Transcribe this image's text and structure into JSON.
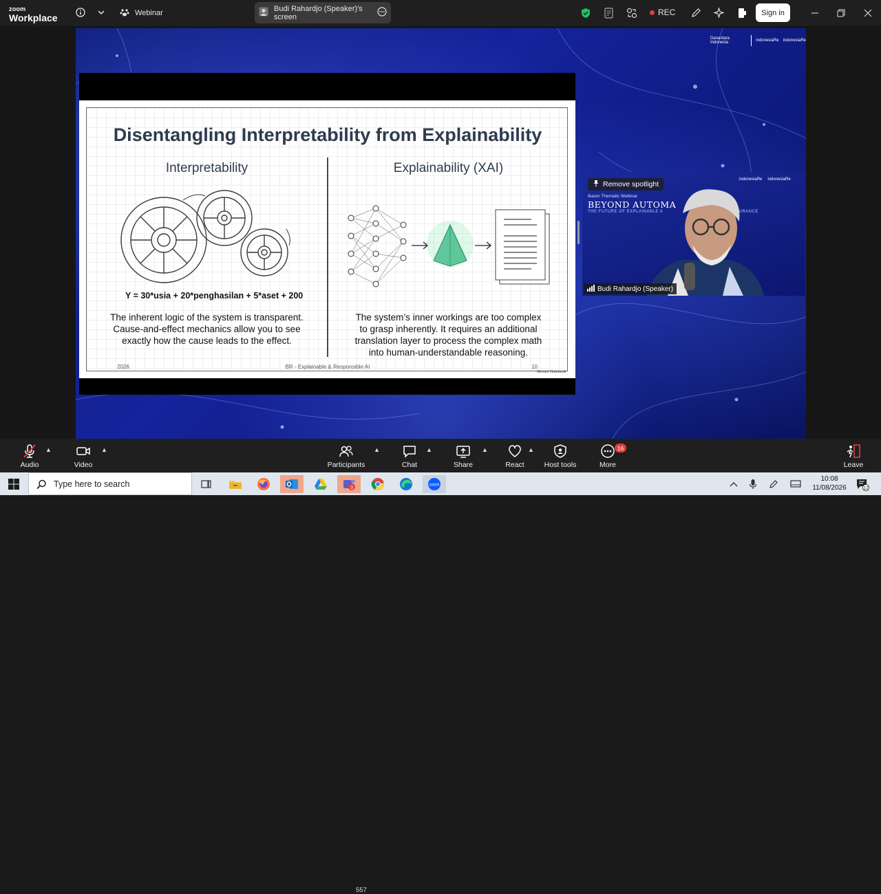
{
  "titlebar": {
    "brand_small": "zoom",
    "brand_large": "Workplace",
    "webinar_label": "Webinar",
    "screen_share_label": "Budi Rahardjo (Speaker)'s screen",
    "rec_label": "REC",
    "signin_label": "Sign in"
  },
  "slide": {
    "title": "Disentangling Interpretability from Explainability",
    "left_heading": "Interpretability",
    "right_heading": "Explainability (XAI)",
    "formula": "Y = 30*usia + 20*penghasilan + 5*aset + 200",
    "left_body": [
      "The inherent logic of the system is transparent.",
      "Cause-and-effect mechanics allow you to see",
      "exactly how the cause leads to the effect."
    ],
    "right_body": [
      "The system’s inner workings are too complex",
      "to grasp inherently. It requires an additional",
      "translation layer to process the complex math",
      "into human-understandable reasoning."
    ],
    "footer_year": "2026",
    "footer_center": "BR - Explainable & Responsible AI",
    "footer_page": "10",
    "watermark": "Gemini Notebook"
  },
  "background": {
    "logo_left": "Danantara Indonesia",
    "logo_mid": "indonesiaRe",
    "logo_right": "indonesiaRe"
  },
  "speaker_tile": {
    "spotlight_label": "Remove spotlight",
    "webinar_small": "Ikaom Thematic Webinar",
    "webinar_title": "BEYOND AUTOMA",
    "webinar_sub": "THE FUTURE OF EXPLAINABLE A",
    "webinar_sub2": "INSURANCE",
    "logo1": "indonesiaRe",
    "logo2": "indonesiaRe",
    "name": "Budi Rahardjo (Speaker)"
  },
  "toolbar": {
    "audio": "Audio",
    "video": "Video",
    "participants": "Participants",
    "participants_count": "557",
    "chat": "Chat",
    "share": "Share",
    "react": "React",
    "host_tools": "Host tools",
    "more": "More",
    "more_badge": "16",
    "leave": "Leave"
  },
  "taskbar": {
    "search_placeholder": "Type here to search",
    "time": "10:08",
    "date": "11/08/2026",
    "notification_count": "12",
    "teams_badge": "3"
  },
  "colors": {
    "titlebar_bg": "#1f1f1f",
    "rec_dot": "#e43d3d",
    "shield_green": "#22c35e",
    "slide_title": "#2e3b4e",
    "badge_red": "#e43d3d"
  }
}
